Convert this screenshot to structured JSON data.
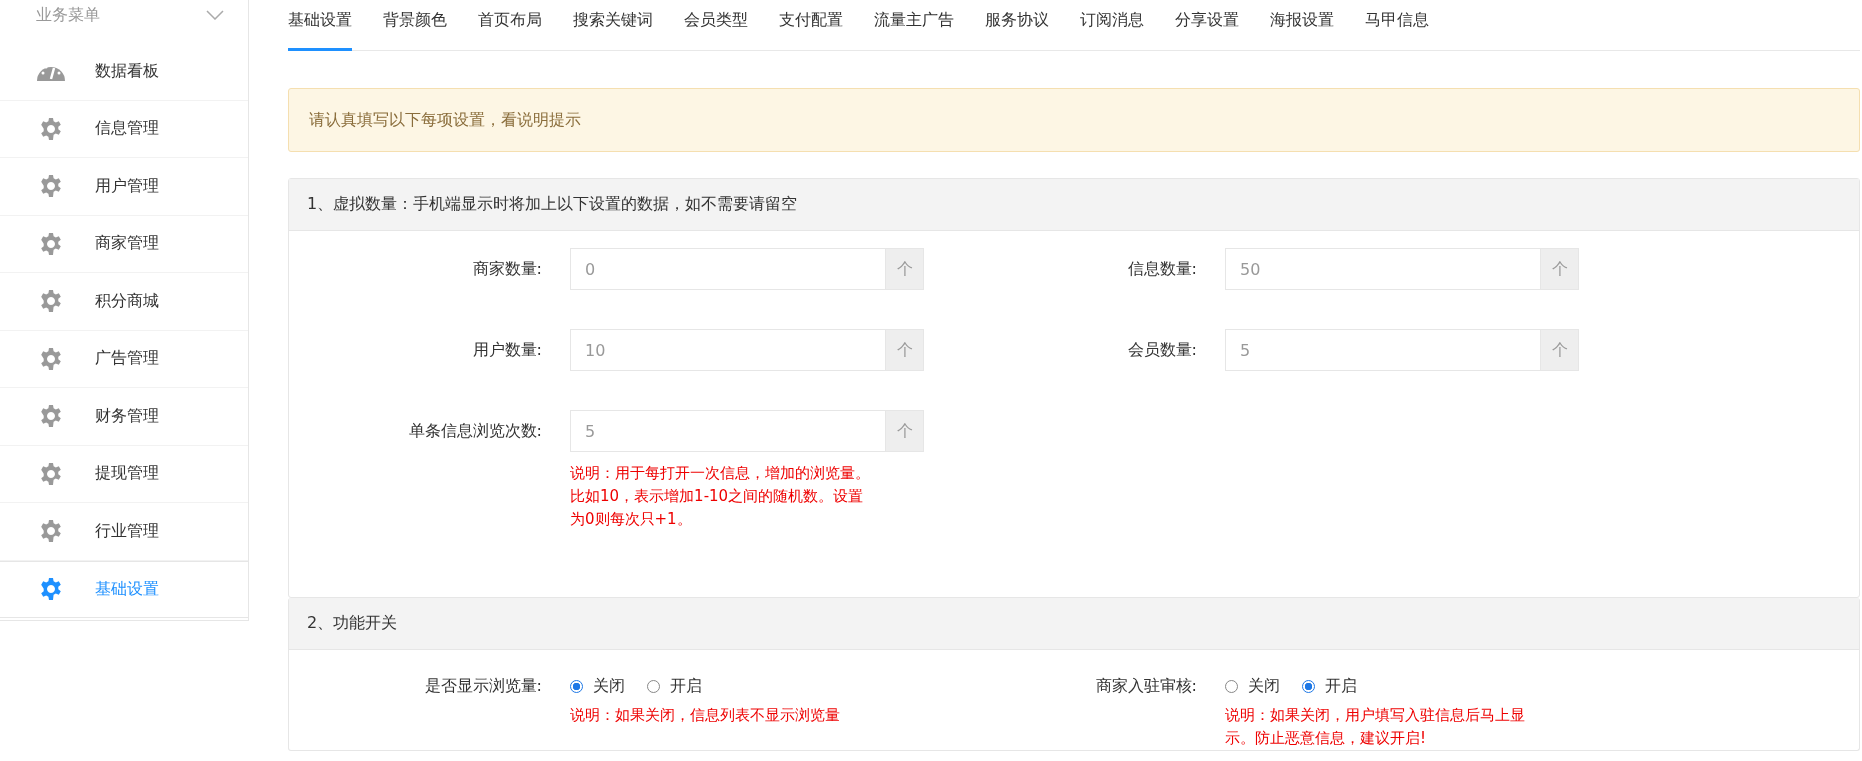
{
  "sidebar": {
    "title": "业务菜单",
    "items": [
      {
        "label": "数据看板",
        "kind": "gauge",
        "selected": false
      },
      {
        "label": "信息管理",
        "kind": "gear",
        "selected": false
      },
      {
        "label": "用户管理",
        "kind": "gear",
        "selected": false
      },
      {
        "label": "商家管理",
        "kind": "gear",
        "selected": false
      },
      {
        "label": "积分商城",
        "kind": "gear",
        "selected": false
      },
      {
        "label": "广告管理",
        "kind": "gear",
        "selected": false
      },
      {
        "label": "财务管理",
        "kind": "gear",
        "selected": false
      },
      {
        "label": "提现管理",
        "kind": "gear",
        "selected": false
      },
      {
        "label": "行业管理",
        "kind": "gear",
        "selected": false
      },
      {
        "label": "基础设置",
        "kind": "gear",
        "selected": true
      }
    ]
  },
  "tabs": [
    {
      "label": "基础设置",
      "selected": true
    },
    {
      "label": "背景颜色",
      "selected": false
    },
    {
      "label": "首页布局",
      "selected": false
    },
    {
      "label": "搜索关键词",
      "selected": false
    },
    {
      "label": "会员类型",
      "selected": false
    },
    {
      "label": "支付配置",
      "selected": false
    },
    {
      "label": "流量主广告",
      "selected": false
    },
    {
      "label": "服务协议",
      "selected": false
    },
    {
      "label": "订阅消息",
      "selected": false
    },
    {
      "label": "分享设置",
      "selected": false
    },
    {
      "label": "海报设置",
      "selected": false
    },
    {
      "label": "马甲信息",
      "selected": false
    }
  ],
  "alert": "请认真填写以下每项设置，看说明提示",
  "sections": [
    {
      "title": "1、虚拟数量：手机端显示时将加上以下设置的数据，如不需要请留空",
      "fields": [
        {
          "kind": "input",
          "label": "商家数量:",
          "value": "0",
          "unit": "个"
        },
        {
          "kind": "input",
          "label": "信息数量:",
          "value": "50",
          "unit": "个"
        },
        {
          "kind": "input",
          "label": "用户数量:",
          "value": "10",
          "unit": "个"
        },
        {
          "kind": "input",
          "label": "会员数量:",
          "value": "5",
          "unit": "个"
        },
        {
          "kind": "input",
          "label": "单条信息浏览次数:",
          "value": "5",
          "unit": "个",
          "note": "说明：用于每打开一次信息，增加的浏览量。比如10，表示增加1-10之间的随机数。设置为0则每次只+1。"
        }
      ]
    },
    {
      "title": "2、功能开关",
      "fields": [
        {
          "kind": "radio",
          "label": "是否显示浏览量:",
          "options": [
            {
              "label": "关闭",
              "selected": true
            },
            {
              "label": "开启",
              "selected": false
            }
          ],
          "note": "说明：如果关闭，信息列表不显示浏览量"
        },
        {
          "kind": "radio",
          "label": "商家入驻审核:",
          "options": [
            {
              "label": "关闭",
              "selected": false
            },
            {
              "label": "开启",
              "selected": true
            }
          ],
          "note": "说明：如果关闭，用户填写入驻信息后马上显示。防止恶意信息，建议开启!"
        }
      ]
    }
  ]
}
